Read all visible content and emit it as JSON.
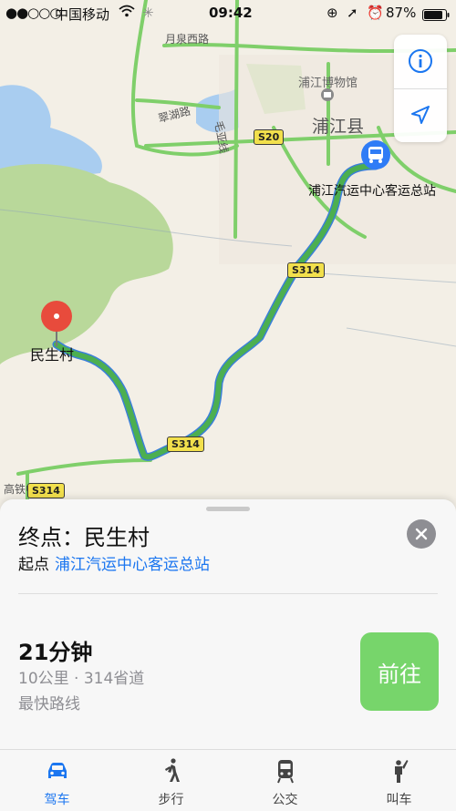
{
  "status_bar": {
    "signal": "●●○○○",
    "carrier": "中国移动",
    "time": "09:42",
    "battery": "87%"
  },
  "map": {
    "place_labels": {
      "museum": "浦江博物馆",
      "county": "浦江县",
      "bus_station": "浦江汽运中心客运总站",
      "village": "民生村"
    },
    "road_labels": {
      "yuequan_west": "月泉西路",
      "cuihu": "翠湖路",
      "maoya": "毛亚线",
      "gaotie": "高铁中路"
    },
    "highway_shields": [
      "S20",
      "S314",
      "S314",
      "S314"
    ],
    "colors": {
      "route": "#4caf50",
      "route_outline": "#3b7fd9",
      "road": "#7fcf6a",
      "water": "#a9cdf0",
      "forest": "#b9d89a",
      "land": "#f3efe6",
      "pin": "#e84b3c",
      "bus_marker": "#2f7cf6"
    },
    "controls": {
      "info_icon": "info-icon",
      "location_icon": "location-arrow-icon"
    }
  },
  "sheet": {
    "dest_label": "终点：民生村",
    "origin_prefix": "起点",
    "origin_name": "浦江汽运中心客运总站",
    "duration": "21分钟",
    "distance": "10公里 · 314省道",
    "route_note": "最快路线",
    "go_label": "前往"
  },
  "tabs": [
    {
      "label": "驾车",
      "icon": "car-icon",
      "active": true
    },
    {
      "label": "步行",
      "icon": "walk-icon",
      "active": false
    },
    {
      "label": "公交",
      "icon": "transit-icon",
      "active": false
    },
    {
      "label": "叫车",
      "icon": "ride-icon",
      "active": false
    }
  ]
}
